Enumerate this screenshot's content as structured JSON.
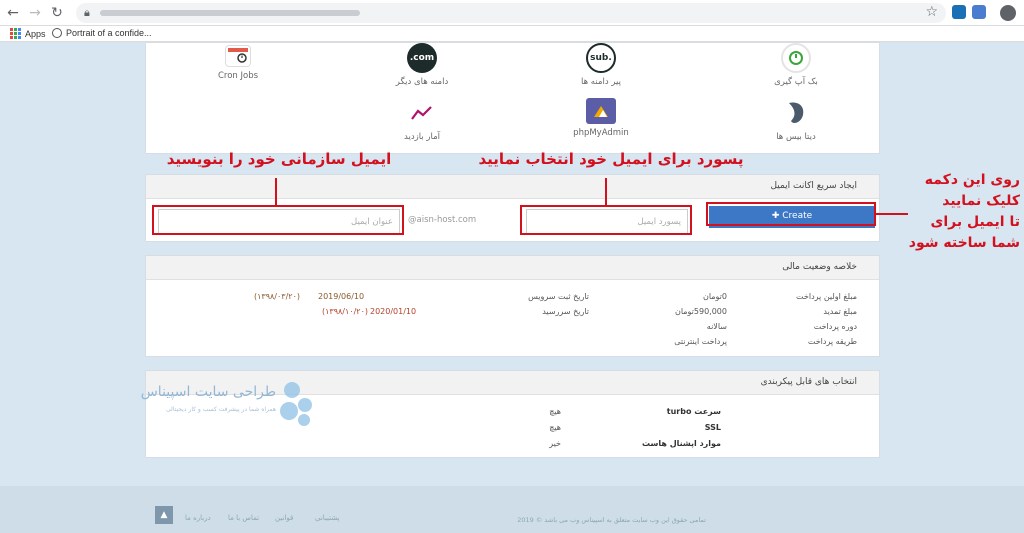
{
  "browser": {
    "bookmarks": [
      {
        "label": "Apps"
      },
      {
        "label": "Portrait of a confide..."
      }
    ]
  },
  "tiles": [
    {
      "label": "Cron Jobs",
      "icon": "cron-icon"
    },
    {
      "label": "دامنه های دیگر",
      "icon_text": ".com"
    },
    {
      "label": "پیر دامنه ها",
      "icon_text": "sub."
    },
    {
      "label": "بک آپ گیری",
      "icon": "backup-icon"
    },
    {
      "label": "آمار بازدید",
      "icon": "stats-icon"
    },
    {
      "label": "phpMyAdmin",
      "icon": "phpmyadmin-icon"
    },
    {
      "label": "دیتا بیس ها",
      "icon": "database-icon"
    }
  ],
  "email_panel": {
    "title": "ایجاد سریع اکانت ایمیل",
    "email_placeholder": "عنوان ایمیل",
    "domain_hint": "@aisn-host.com",
    "password_placeholder": "پسورد ایمیل",
    "create_label": "Create"
  },
  "annotations": {
    "email_note": "ایمیل سازمانی خود را بنویسید",
    "password_note": "پسورد برای ایمیل خود انتخاب نمایید",
    "button_note_1": "روی این دکمه",
    "button_note_2": "کلیک نمایید",
    "button_note_3": "تا ایمیل برای",
    "button_note_4": "شما ساخته شود"
  },
  "finance_panel": {
    "title": "خلاصه وضعیت مالی",
    "rows_right": [
      {
        "label": "مبلغ اولین پرداخت",
        "value": "0تومان"
      },
      {
        "label": "مبلغ تمدید",
        "value": "590,000تومان"
      },
      {
        "label": "دوره پرداخت",
        "value": "سالانه"
      },
      {
        "label": "طریقه پرداخت",
        "value": "پرداخت اینترنتی"
      }
    ],
    "rows_left": [
      {
        "label": "تاریخ ثبت سرویس",
        "value": "2019/06/10",
        "jalali": "(۱۳۹۸/۰۳/۲۰)"
      },
      {
        "label": "تاریخ سررسید",
        "value": "2020/01/10",
        "jalali": "(۱۳۹۸/۱۰/۲۰)"
      }
    ]
  },
  "config_panel": {
    "title": "انتخاب های قابل پیکربندی",
    "rows": [
      {
        "label": "سرعت turbo",
        "value": "هیچ"
      },
      {
        "label": "SSL",
        "value": "هیچ"
      },
      {
        "label": "موارد اپشنال هاست",
        "value": "خیر"
      }
    ]
  },
  "watermark": {
    "title": "طراحی سایت اسپیناس",
    "subtitle": "همراه شما در پیشرفت کسب و کار دیجیتالی"
  },
  "footer": {
    "links": [
      "درباره ما",
      "تماس با ما",
      "قوانین",
      "پشتیبانی"
    ],
    "copyright": "تمامی حقوق این وب سایت متعلق به اسپیناس وب می باشد © 2019",
    "up_icon": "arrow-up-icon"
  },
  "colors": {
    "accent": "#3c78c6",
    "annotation": "#d3101e",
    "page_bg": "#d8e6f2"
  }
}
